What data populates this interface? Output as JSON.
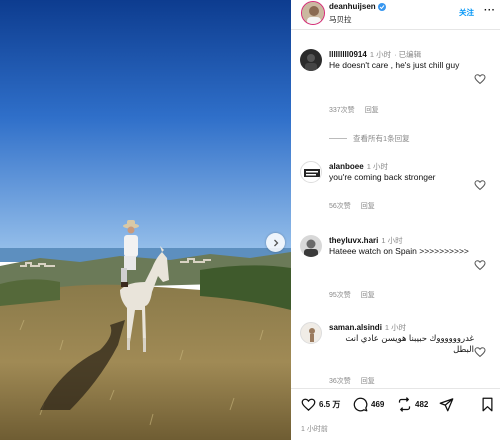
{
  "post": {
    "username": "deanhuijsen",
    "location": "马贝拉",
    "follow_label": "关注",
    "more_label": "···",
    "likes": "6.5 万",
    "comments_count": "469",
    "reposts_count": "482",
    "posted_time": "1 小时前"
  },
  "comments": [
    {
      "username": "lllllllll0914",
      "time": "1 小时",
      "edited": "· 已编辑",
      "text": "He doesn't care , he's just chill guy",
      "likes": "337次赞",
      "reply_label": "回复",
      "view_replies": "查看所有1条回复"
    },
    {
      "username": "alanboee",
      "time": "1 小时",
      "avatar_text": "I like TACOS",
      "text": "you're coming back stronger",
      "likes": "56次赞",
      "reply_label": "回复"
    },
    {
      "username": "theyluvx.hari",
      "time": "1 小时",
      "text": "Hateee watch on Spain >>>>>>>>>>",
      "likes": "95次赞",
      "reply_label": "回复"
    },
    {
      "username": "saman.alsindi",
      "time": "1 小时",
      "text": "غدرووووووك حبيبنا هويسن عادي انت البطل",
      "likes": "36次赞",
      "reply_label": "回复"
    }
  ],
  "colors": {
    "verified": "#3897f0",
    "follow": "#0095f6",
    "sky_top": "#0d3c8f",
    "sky_bottom": "#7fb2e6"
  },
  "icons": [
    "verified-icon",
    "heart-icon",
    "comment-icon",
    "repost-icon",
    "share-icon",
    "bookmark-icon",
    "chevron-right-icon"
  ]
}
